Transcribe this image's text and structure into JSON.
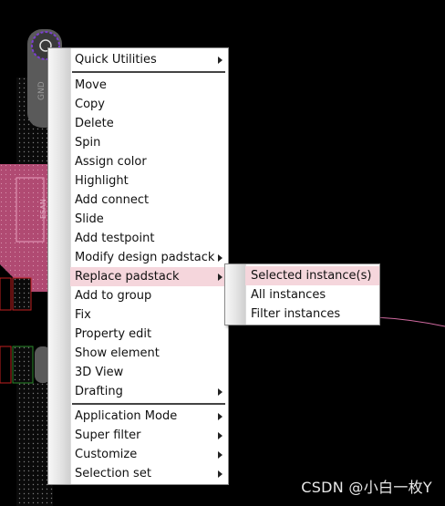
{
  "canvas": {
    "pad_label": "GND",
    "pin_label": "ESAN"
  },
  "context_menu": {
    "items": [
      {
        "label": "Quick Utilities",
        "has_submenu": true
      },
      {
        "label": "Move",
        "has_submenu": false
      },
      {
        "label": "Copy",
        "has_submenu": false
      },
      {
        "label": "Delete",
        "has_submenu": false
      },
      {
        "label": "Spin",
        "has_submenu": false
      },
      {
        "label": "Assign color",
        "has_submenu": false
      },
      {
        "label": "Highlight",
        "has_submenu": false
      },
      {
        "label": "Add connect",
        "has_submenu": false
      },
      {
        "label": "Slide",
        "has_submenu": false
      },
      {
        "label": "Add testpoint",
        "has_submenu": false
      },
      {
        "label": "Modify design padstack",
        "has_submenu": true
      },
      {
        "label": "Replace padstack",
        "has_submenu": true,
        "highlighted": true
      },
      {
        "label": "Add to group",
        "has_submenu": false
      },
      {
        "label": "Fix",
        "has_submenu": false
      },
      {
        "label": "Property edit",
        "has_submenu": false
      },
      {
        "label": "Show element",
        "has_submenu": false
      },
      {
        "label": "3D View",
        "has_submenu": false
      },
      {
        "label": "Drafting",
        "has_submenu": true
      },
      {
        "label": "Application Mode",
        "has_submenu": true
      },
      {
        "label": "Super filter",
        "has_submenu": true
      },
      {
        "label": "Customize",
        "has_submenu": true
      },
      {
        "label": "Selection set",
        "has_submenu": true
      }
    ]
  },
  "submenu": {
    "items": [
      {
        "label": "Selected instance(s)",
        "highlighted": true
      },
      {
        "label": "All instances"
      },
      {
        "label": "Filter instances"
      }
    ]
  },
  "watermark": "CSDN @小白一枚Y",
  "colors": {
    "background": "#000000",
    "pcb_pink": "#c0507a",
    "menu_highlight": "#f5d6dc"
  }
}
